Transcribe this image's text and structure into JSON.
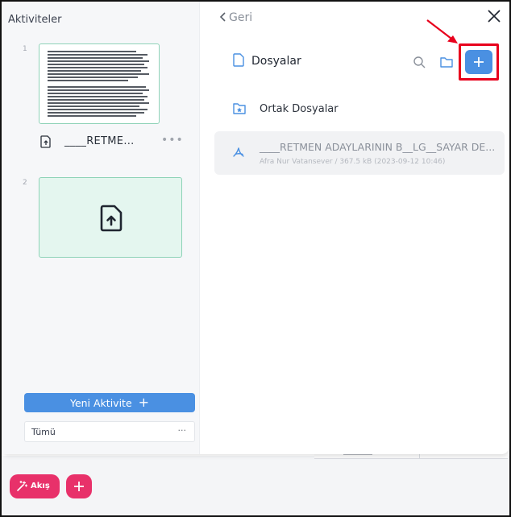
{
  "left_panel": {
    "title": "Aktiviteler",
    "slots": [
      {
        "number": "1",
        "file_name": "____RETME...",
        "more": "•••"
      },
      {
        "number": "2"
      }
    ],
    "new_activity_label": "Yeni Aktivite",
    "new_activity_plus": "+",
    "filter": {
      "value": "Tümü",
      "more": "···"
    }
  },
  "right_panel": {
    "back_label": "Geri",
    "section_title": "Dosyalar",
    "shared_folder_label": "Ortak Dosyalar",
    "files": [
      {
        "name": "____RETMEN ADAYLARININ B__LG__SAYAR DE...",
        "meta": "Afra Nur Vatansever  /  367.5 kB (2023-09-12 10:46)"
      }
    ]
  },
  "bottom_bar": {
    "flow_label": "Akış"
  },
  "colors": {
    "primary_blue": "#4a90e2",
    "accent_pink": "#e8316a",
    "thumb_green": "#e4f6ef",
    "thumb_border": "#8fd3b8",
    "highlight_red": "#e8001c"
  },
  "icons": [
    "close-icon",
    "chevron-left-icon",
    "file-icon",
    "search-icon",
    "folder-icon",
    "plus-icon",
    "shared-folder-icon",
    "pdf-icon",
    "file-upload-icon",
    "magic-wand-icon"
  ]
}
